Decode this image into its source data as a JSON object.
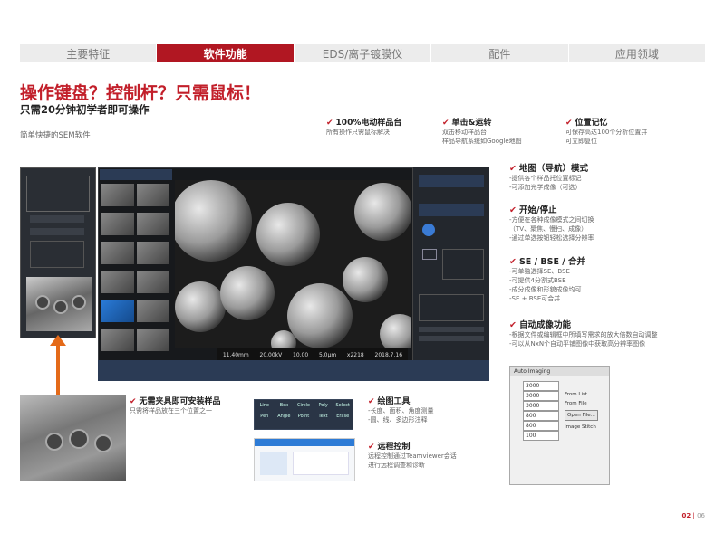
{
  "tabs": [
    {
      "label": "主要特征",
      "active": false
    },
    {
      "label": "软件功能",
      "active": true
    },
    {
      "label": "EDS/离子镀膜仪",
      "active": false
    },
    {
      "label": "配件",
      "active": false
    },
    {
      "label": "应用领域",
      "active": false
    }
  ],
  "headline": "操作键盘？控制杆？只需鼠标！",
  "subheadline": "只需20分钟初学者即可操作",
  "intro": "简单快捷的SEM软件",
  "top_features": [
    {
      "title": "100%电动样品台",
      "lines": [
        "所有操作只需鼠标解决"
      ]
    },
    {
      "title": "单击&运转",
      "lines": [
        "双击移动样品台",
        "样品导航系统如Google地图"
      ]
    },
    {
      "title": "位置记忆",
      "lines": [
        "可保存高达100个分析位置并",
        "可立即复位"
      ]
    }
  ],
  "right_features": [
    {
      "title": "地图（导航）模式",
      "lines": [
        "-提供各个样品托位置标记",
        "-可添加光学成像（可选）"
      ]
    },
    {
      "title": "开始/停止",
      "lines": [
        "-方便在各种成像模式之间切换",
        "（TV、聚焦、慢扫、成像）",
        "-通过单选按钮轻松选择分辨率"
      ]
    },
    {
      "title": "SE / BSE / 合并",
      "lines": [
        "-可单独选择SE、BSE",
        "-可提供4分割式BSE",
        "-成分成像和形貌成像均可",
        "-SE + BSE可合并"
      ]
    },
    {
      "title": "自动成像功能",
      "lines": [
        "-根据文件或编辑框中所填写需求的放大倍数自动调整",
        "-可以从NxN个自动平铺图像中获取高分辨率图像"
      ]
    }
  ],
  "bottom_features": [
    {
      "title": "无需夹具即可安装样品",
      "lines": [
        "只需将样品放在三个位置之一"
      ]
    },
    {
      "title": "绘图工具",
      "lines": [
        "-长度、面积、角度测量",
        "-圆、线、多边形注释"
      ]
    },
    {
      "title": "远程控制",
      "lines": [
        "远程控制通过Teamviewer会话",
        "进行远程调查和诊断"
      ]
    }
  ],
  "sem_info": {
    "wd": "WD",
    "hv": "HV",
    "probe": "Probe",
    "wd_val": "11.40mm",
    "hv_val": "20.00kV",
    "probe_val": "10.00",
    "scale": "5.0μm",
    "mag": "x2218",
    "date": "2018.7.16",
    "det": "DET",
    "det_val": "SEI"
  },
  "tool_labels": [
    "Line",
    "Box",
    "Circle",
    "Poly",
    "Select",
    "Pen",
    "Angle",
    "Point",
    "Text",
    "Erase"
  ],
  "auto_imaging": {
    "title": "Auto Imaging",
    "values": [
      "3000",
      "3000",
      "3000",
      "800",
      "800",
      "100"
    ],
    "options": [
      "From List",
      "From File",
      "Image Stitch"
    ],
    "open_button": "Open File..."
  },
  "page": {
    "current": "02",
    "total": "06"
  },
  "colors": {
    "brand_red": "#b11722",
    "arrow_orange": "#e46a19"
  }
}
